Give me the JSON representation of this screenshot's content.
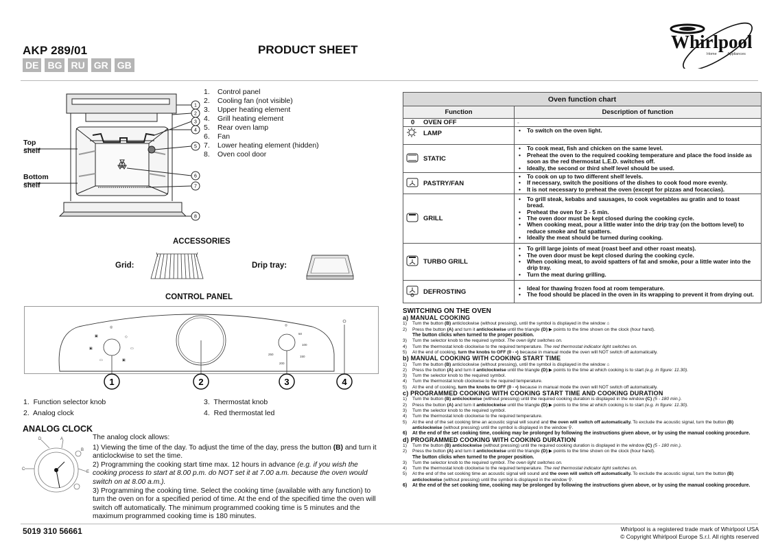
{
  "header": {
    "model": "AKP 289/01",
    "title": "PRODUCT SHEET",
    "languages": [
      "DE",
      "BG",
      "RU",
      "GR",
      "GB"
    ],
    "brand": "Whirlpool",
    "brand_tagline_left": "Home",
    "brand_tagline_right": "Appliances"
  },
  "oven_diagram": {
    "top_shelf": "Top shelf",
    "bottom_shelf": "Bottom shelf",
    "callouts": [
      "1",
      "2",
      "3",
      "4",
      "5",
      "6",
      "7",
      "8"
    ],
    "parts": [
      {
        "num": "1.",
        "label": "Control panel"
      },
      {
        "num": "2.",
        "label": "Cooling fan (not visible)"
      },
      {
        "num": "3.",
        "label": "Upper heating element"
      },
      {
        "num": "4.",
        "label": "Grill heating element"
      },
      {
        "num": "5.",
        "label": "Rear oven lamp"
      },
      {
        "num": "6.",
        "label": "Fan"
      },
      {
        "num": "7.",
        "label": "Lower heating element (hidden)"
      },
      {
        "num": "8.",
        "label": "Oven cool door"
      }
    ]
  },
  "accessories": {
    "heading": "ACCESSORIES",
    "grid_label": "Grid:",
    "drip_tray_label": "Drip tray:"
  },
  "control_panel": {
    "heading": "CONTROL PANEL",
    "callouts": [
      "1",
      "2",
      "3",
      "4"
    ],
    "thermostat_marks": [
      "50",
      "100",
      "150",
      "200",
      "250"
    ],
    "legend": [
      {
        "num": "1.",
        "label": "Function selector knob"
      },
      {
        "num": "2.",
        "label": "Analog clock"
      },
      {
        "num": "3.",
        "label": "Thermostat knob"
      },
      {
        "num": "4.",
        "label": "Red thermostat led"
      }
    ]
  },
  "analog_clock": {
    "heading": "ANALOG CLOCK",
    "labels": [
      "A",
      "B",
      "C",
      "D",
      "E"
    ],
    "intro": "The analog clock allows:",
    "p1": "1) Viewing the time of the day. To adjust the time of the day, press the button ",
    "p1_bold": "(B)",
    "p1_end": " and turn it anticlockwise to set the time.",
    "p2": "2) Programming the cooking start time max. 12 hours in advance ",
    "p2_italic": "(e.g. if you wish the cooking process to start at 8.00 p.m. do NOT set it at 7.00 a.m. because the oven would switch on at 8.00 a.m.).",
    "p3": "3) Programming the cooking time. Select the cooking time (available with any function) to turn the oven on for a specified period of time. At the end of the specified time the oven will switch off automatically. The minimum programmed cooking time is 5 minutes and the maximum programmed cooking time is 180 minutes."
  },
  "function_chart": {
    "caption": "Oven function chart",
    "col_function": "Function",
    "col_description": "Description of function",
    "rows": [
      {
        "icon": "zero",
        "name": "OVEN OFF",
        "prefix": "0",
        "desc": [
          "-"
        ]
      },
      {
        "icon": "lamp-icon",
        "name": "LAMP",
        "desc": [
          "To switch on the oven light."
        ]
      },
      {
        "icon": "static-icon",
        "name": "STATIC",
        "desc": [
          "To cook meat, fish and chicken on the same level.",
          "Preheat the oven to the required cooking temperature and place the food inside as soon as the red thermostat L.E.D. switches off.",
          "Ideally, the second or third shelf level should be used."
        ]
      },
      {
        "icon": "pastry-fan-icon",
        "name": "PASTRY/FAN",
        "desc": [
          "To cook on up to two different shelf levels.",
          "If necessary, switch the positions of the dishes to cook food more evenly.",
          "It is not necessary to preheat the oven (except for pizzas and focaccias)."
        ]
      },
      {
        "icon": "grill-icon",
        "name": "GRILL",
        "desc": [
          "To grill steak, kebabs and sausages, to cook vegetables au gratin and to toast bread.",
          "Preheat the oven for 3 - 5 min.",
          "The oven door must be kept closed during the cooking cycle.",
          "When cooking meat, pour a little water into the drip tray (on the bottom level) to reduce smoke and fat spatters.",
          "Ideally the meat should be turned during cooking."
        ]
      },
      {
        "icon": "turbo-grill-icon",
        "name": "TURBO GRILL",
        "desc": [
          "To grill large joints of meat (roast beef and other roast meats).",
          "The oven door must be kept closed during the cooking cycle.",
          "When cooking meat, to avoid spatters of fat and smoke, pour a little water into the drip tray.",
          "Turn the meat during grilling."
        ]
      },
      {
        "icon": "defrost-icon",
        "name": "DEFROSTING",
        "desc": [
          "Ideal for thawing frozen food at room temperature.",
          "The food should be placed in the oven in its wrapping to prevent it from drying out."
        ]
      }
    ]
  },
  "switching": {
    "heading": "SWITCHING ON THE OVEN",
    "a_title": "a) MANUAL COOKING",
    "a": [
      {
        "n": "1)",
        "t": "Turn the button <b>(B)</b> anticlockwise (without pressing), until the symbol is displayed in the window ⌂"
      },
      {
        "n": "2)",
        "t": "Press the button <b>(A)</b> and turn it <b>anticlockwise</b> until the triangle <b>(D)</b> ▶ points to the time shown on the clock (hour hand)."
      },
      {
        "n": "",
        "t": "The button clicks when turned to the proper position.",
        "sub": true
      },
      {
        "n": "3)",
        "t": "Turn the selector knob to the required symbol. <i>The oven light switches on.</i>"
      },
      {
        "n": "4)",
        "t": "Turn the thermostat knob clockwise to the required temperature. <i>The red thermostat indicator light switches on.</i>"
      },
      {
        "n": "5)",
        "t": "At the end of cooking, <b>turn the knobs to OFF (0 - •)</b> because in manual mode the oven will NOT switch off automatically."
      }
    ],
    "b_title": "b) MANUAL COOKING WITH COOKING START TIME",
    "b": [
      {
        "n": "1)",
        "t": "Turn the button <b>(B)</b> anticlockwise (without pressing), until the symbol is displayed in the window ⌂"
      },
      {
        "n": "2)",
        "t": "Press the button <b>(A)</b> and turn it <b>anticlockwise</b> until the triangle <b>(D)</b> ▶ points to the time at which cooking is to start <i>(e.g. in figure: 11.30).</i>"
      },
      {
        "n": "3)",
        "t": "Turn the selector knob to the required symbol."
      },
      {
        "n": "4)",
        "t": "Turn the thermostat knob clockwise to the required temperature."
      },
      {
        "n": "5)",
        "t": "At the end of cooking, <b>turn the knobs to OFF (0 - •)</b> because in manual mode the oven will NOT switch off automatically."
      }
    ],
    "c_title": "c) PROGRAMMED COOKING WITH COOKING START TIME AND COOKING DURATION",
    "c": [
      {
        "n": "1)",
        "t": "Turn the button <b>(B) anticlockwise</b> (without pressing) until the required cooking duration is displayed in the window <b>(C)</b> <i>(5 - 180 min.).</i>"
      },
      {
        "n": "2)",
        "t": "Press the button <b>(A)</b> and turn it <b>anticlockwise</b> until the triangle <b>(D)</b> ▶ points to the time at which cooking is to start <i>(e.g. in figure: 11.30).</i>"
      },
      {
        "n": "3)",
        "t": "Turn the selector knob to the required symbol."
      },
      {
        "n": "4)",
        "t": "Turn the thermostat knob clockwise to the required temperature."
      },
      {
        "n": "5)",
        "t": "At the end of the set cooking time an acoustic signal will sound and <b>the oven will switch off automatically.</b> To exclude the acoustic signal, turn the button <b>(B) anticlockwise</b> (without pressing) until the symbol is displayed in the window ⚲."
      },
      {
        "n": "6)",
        "t": "At the end of the set cooking time, cooking may be prolonged by following the instructions given above, or by using the manual cooking procedure.",
        "bold": true
      }
    ],
    "d_title": "d) PROGRAMMED COOKING WITH COOKING DURATION",
    "d": [
      {
        "n": "1)",
        "t": "Turn the button <b>(B) anticlockwise</b> (without pressing) until the required cooking duration is displayed in the window <b>(C)</b> <i>(5 - 180 min.).</i>"
      },
      {
        "n": "2)",
        "t": "Press the button <b>(A)</b> and turn it <b>anticlockwise</b> until the triangle <b>(D)</b> ▶ points to the time shown on the clock (hour hand)."
      },
      {
        "n": "",
        "t": "The button clicks when turned to the proper position.",
        "sub": true
      },
      {
        "n": "3)",
        "t": "Turn the selector knob to the required symbol. <i>The oven light switches on.</i>"
      },
      {
        "n": "4)",
        "t": "Turn the thermostat knob clockwise to the required temperature. <i>The red thermostat indicator light switches on.</i>"
      },
      {
        "n": "5)",
        "t": "At the end of the set cooking time an acoustic signal will sound and <b>the oven will switch off automatically.</b> To exclude the acoustic signal, turn the button <b>(B) anticlockwise</b> (without pressing) until the symbol is displayed in the window ⚲."
      },
      {
        "n": "6)",
        "t": "At the end of the set cooking time, cooking may be prolonged by following the instructions given above, or by using the manual cooking procedure.",
        "bold": true
      }
    ]
  },
  "footer": {
    "code": "5019 310 56661",
    "trademark": "Whirlpool is a registered trade mark of Whirlpool USA",
    "copyright": "© Copyright Whirlpool Europe S.r.l. All rights reserved"
  },
  "colors": {
    "lang_badge": "#b5b5b5",
    "table_caption_bg": "#d9d9d9",
    "rule": "#b8b8b8"
  }
}
